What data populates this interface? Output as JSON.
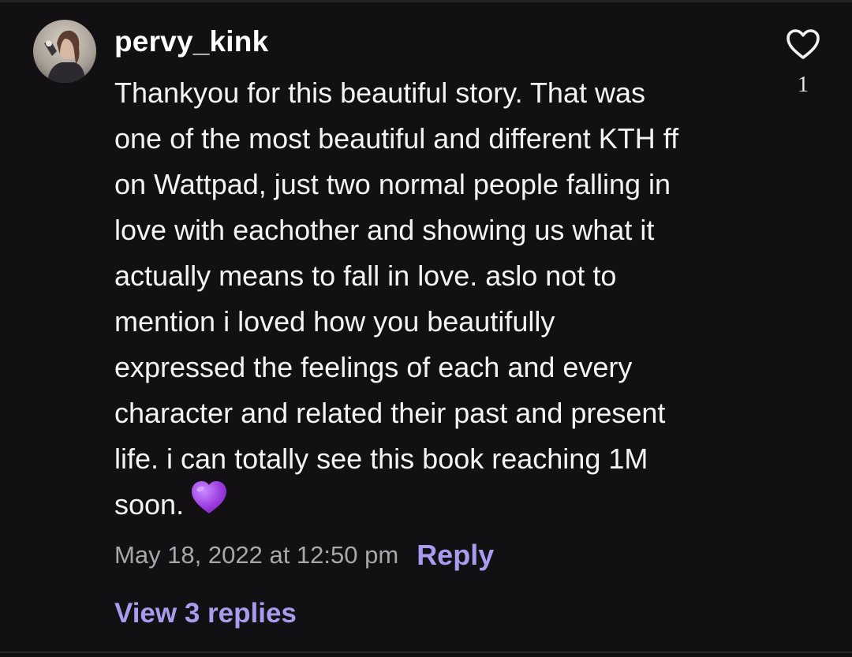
{
  "comment": {
    "username": "pervy_kink",
    "body_lines": [
      "Thankyou for this beautiful story. That was",
      "one of the most beautiful and different KTH ff",
      "on Wattpad, just two normal people falling in",
      "love with eachother and showing us what it",
      "actually means to fall in love. aslo not to",
      "mention i loved how you beautifully",
      "expressed the feelings of each and every",
      "character and related their past and present",
      "life. i can totally see this book reaching 1M",
      "soon."
    ],
    "emoji": "purple-heart",
    "timestamp": "May 18, 2022 at 12:50 pm",
    "reply_label": "Reply",
    "view_replies_label": "View 3 replies",
    "like_count": "1",
    "like_icon": "heart-outline-icon"
  },
  "colors": {
    "background": "#121013",
    "text": "#f4f4f4",
    "muted": "#a9a7ad",
    "accent": "#a99bee",
    "emoji_heart": "#9d3fe0"
  }
}
